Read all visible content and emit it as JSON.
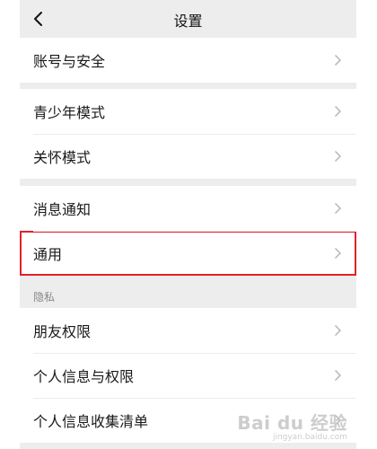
{
  "header": {
    "title": "设置"
  },
  "groups": [
    {
      "items": [
        {
          "label": "账号与安全"
        }
      ]
    },
    {
      "items": [
        {
          "label": "青少年模式"
        },
        {
          "label": "关怀模式"
        }
      ]
    },
    {
      "items": [
        {
          "label": "消息通知"
        },
        {
          "label": "通用"
        }
      ]
    },
    {
      "caption": "隐私",
      "items": [
        {
          "label": "朋友权限"
        },
        {
          "label": "个人信息与权限"
        },
        {
          "label": "个人信息收集清单"
        }
      ]
    }
  ],
  "highlight": {
    "item": "通用",
    "color": "#e0212b"
  },
  "watermark": {
    "main": "Bai du 经验",
    "sub": "jingyan.baidu.com"
  },
  "colors": {
    "background": "#ededed",
    "surface": "#ffffff",
    "text": "#191919",
    "caption": "#888888",
    "divider": "#ececec"
  }
}
